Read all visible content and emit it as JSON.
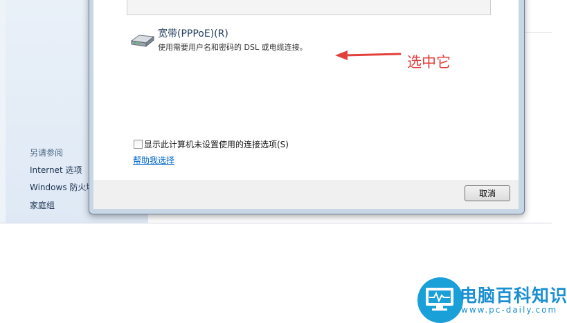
{
  "sidebar": {
    "heading": "另请参阅",
    "items": [
      {
        "label": "Internet 选项"
      },
      {
        "label": "Windows 防火墙"
      },
      {
        "label": "家庭组"
      }
    ]
  },
  "dialog": {
    "option": {
      "title": "宽带(PPPoE)(R)",
      "description": "使用需要用户名和密码的 DSL 或电缆连接。"
    },
    "checkbox_label": "显示此计算机未设置使用的连接选项(S)",
    "help_link": "帮助我选择",
    "cancel_label": "取消"
  },
  "annotation": {
    "text": "选中它",
    "color": "#e2403b"
  },
  "watermark": {
    "title": "电脑百科知识",
    "url": "www.pc-daily.com",
    "color": "#1aa0d8"
  }
}
